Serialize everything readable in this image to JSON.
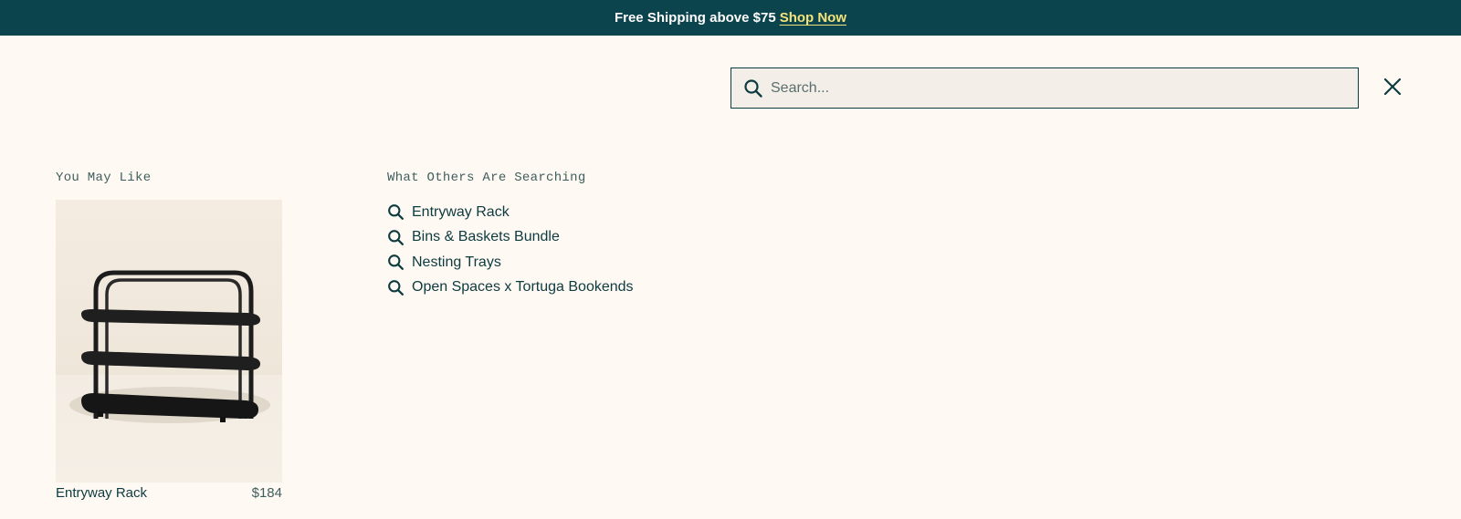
{
  "announcement": {
    "message": "Free Shipping above $75",
    "link_label": "Shop Now"
  },
  "search": {
    "placeholder": "Search...",
    "value": "",
    "search_icon": "search-icon",
    "close_icon": "close-icon"
  },
  "you_may_like": {
    "heading": "You May Like",
    "products": [
      {
        "name": "Entryway Rack",
        "price": "$184",
        "image": "entryway-rack-product-image"
      }
    ]
  },
  "others_searching": {
    "heading": "What Others Are Searching",
    "items": [
      {
        "label": "Entryway Rack",
        "icon": "search-icon"
      },
      {
        "label": "Bins & Baskets Bundle",
        "icon": "search-icon"
      },
      {
        "label": "Nesting Trays",
        "icon": "search-icon"
      },
      {
        "label": "Open Spaces x Tortuga Bookends",
        "icon": "search-icon"
      }
    ]
  },
  "colors": {
    "banner_bg": "#0b444d",
    "banner_link": "#f4e37a",
    "page_bg": "#fef9f2",
    "text_primary": "#0d3b40",
    "search_field_bg": "#f3efe8"
  }
}
